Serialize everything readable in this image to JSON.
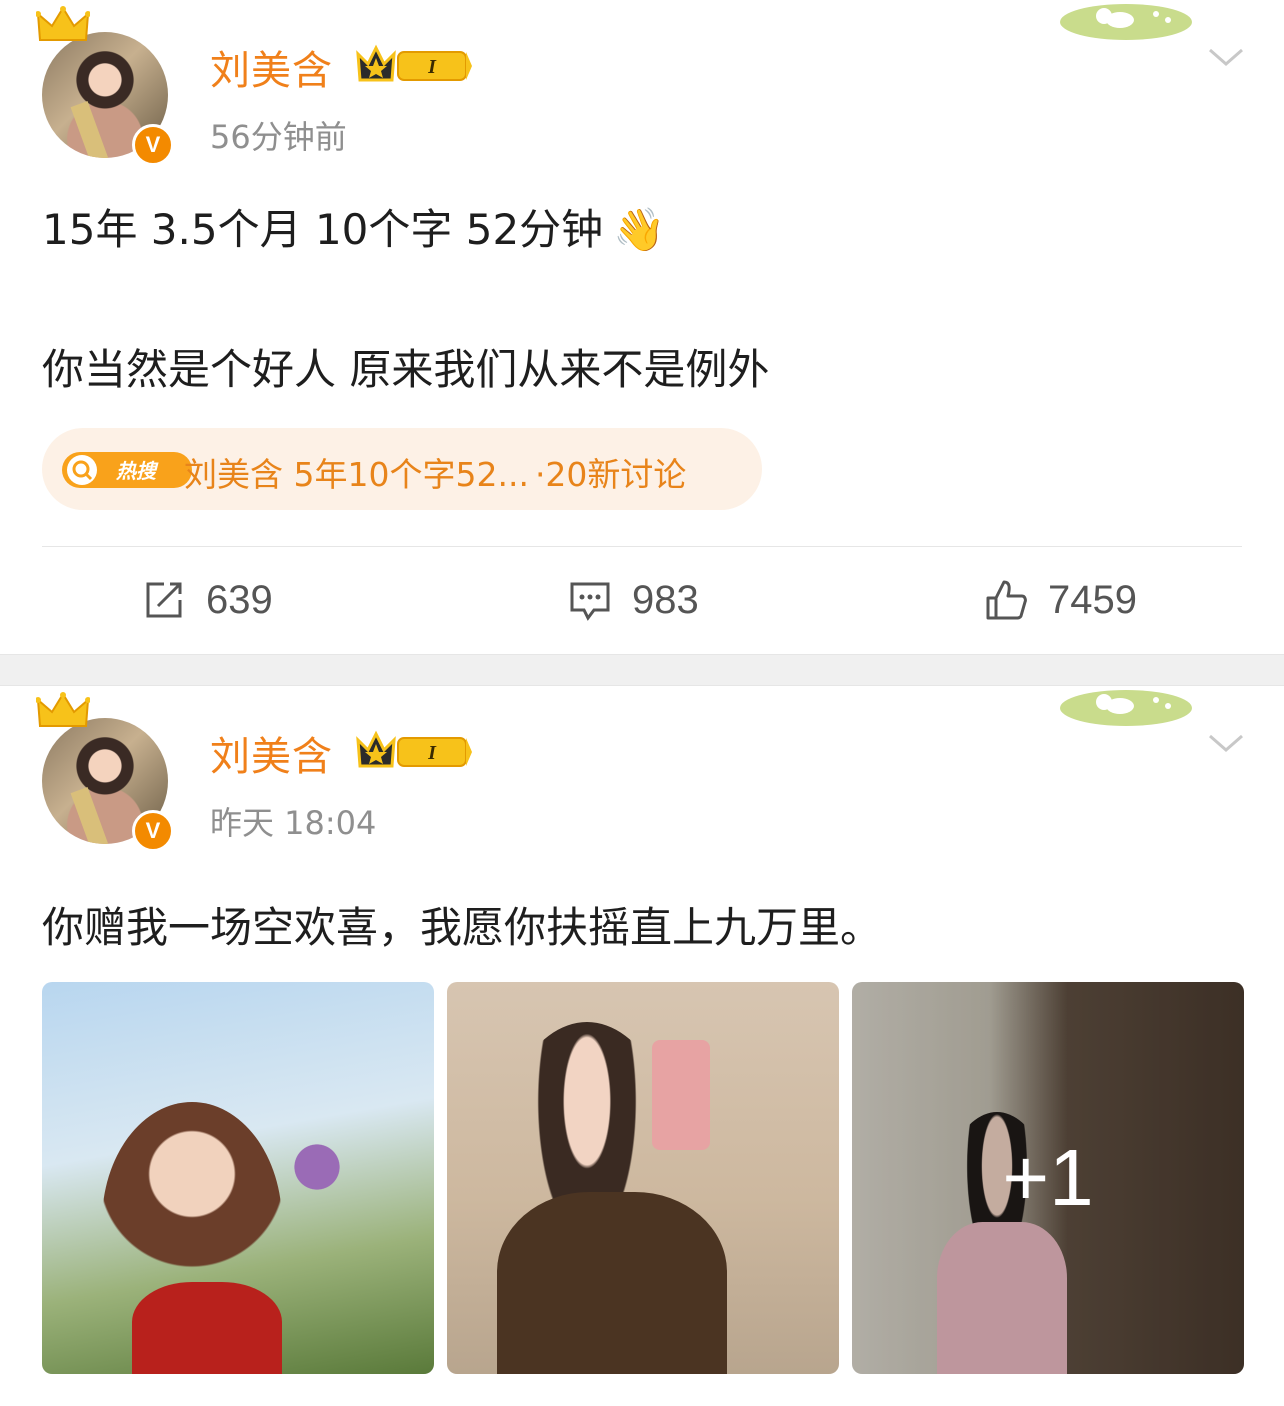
{
  "posts": [
    {
      "username": "刘美含",
      "level": "I",
      "verified_mark": "V",
      "timestamp": "56分钟前",
      "lines": [
        "15年 3.5个月 10个字 52分钟",
        "你当然是个好人   原来我们从来不是例外"
      ],
      "emoji": "👋",
      "hot_search": {
        "tag": "热搜",
        "title": "刘美含 5年10个字52...",
        "discussion": "·20新讨论"
      },
      "actions": {
        "repost": "639",
        "comment": "983",
        "like": "7459"
      }
    },
    {
      "username": "刘美含",
      "level": "I",
      "verified_mark": "V",
      "timestamp": "昨天 18:04",
      "lines": [
        "你赠我一场空欢喜，我愿你扶摇直上九万里。"
      ],
      "images_more": "+1"
    }
  ],
  "colors": {
    "username": "#f0801a",
    "timestamp": "#8f8f8f",
    "hot_bg": "#fdf1e6",
    "hot_text": "#e8841a",
    "separator": "#f0f0f0"
  },
  "icons": [
    "crown-icon",
    "verified-icon",
    "level-badge-icon",
    "chevron-down-icon",
    "hot-search-icon",
    "repost-icon",
    "comment-icon",
    "like-icon"
  ]
}
